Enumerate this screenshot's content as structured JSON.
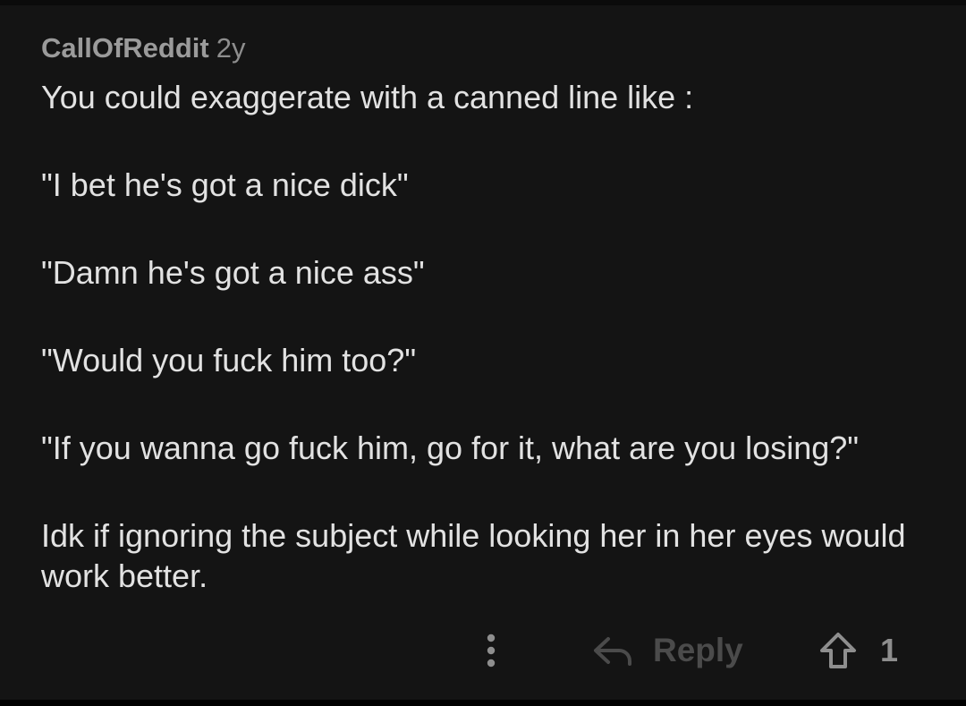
{
  "comment": {
    "author": "CallOfReddit",
    "age": "2y",
    "paragraphs": [
      "You could exaggerate with a canned line like :",
      "\"I bet he's got a nice dick\"",
      "\"Damn he's got a nice ass\"",
      "\"Would you fuck him too?\"",
      "\"If you wanna go fuck him, go for it, what are you losing?\"",
      "Idk if ignoring the subject while looking her in her eyes would work better."
    ]
  },
  "actions": {
    "more_icon": "vertical-dots-icon",
    "reply_icon": "reply-arrow-icon",
    "reply_label": "Reply",
    "upvote_icon": "upvote-arrow-icon",
    "upvote_count": "1"
  },
  "colors": {
    "background": "#141414",
    "text": "#e2e2e2",
    "meta": "#9b9b9b",
    "muted_action": "#4b4b4b"
  }
}
